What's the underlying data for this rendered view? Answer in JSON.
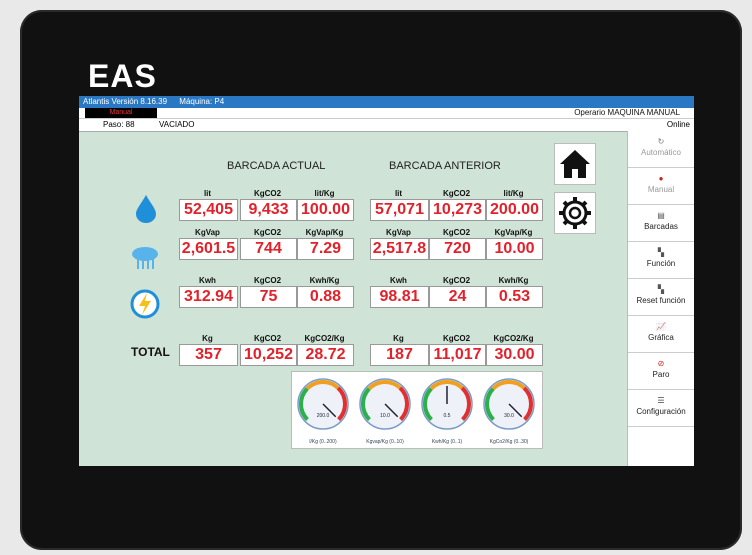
{
  "brand": "EAS",
  "header": {
    "version": "Atlantis Versión 8.16.39",
    "machine": "Máquina: P4",
    "mode_tag": "Manual",
    "operator": "Operario  MAQUINA MANUAL",
    "step": "Paso: 88",
    "step_name": "VACIADO",
    "connection": "Online"
  },
  "sections": {
    "actual": "BARCADA ACTUAL",
    "anterior": "BARCADA ANTERIOR",
    "total_label": "TOTAL"
  },
  "rows": [
    {
      "icon": "water-drop-icon",
      "headers": [
        "lit",
        "KgCO2",
        "lit/Kg"
      ],
      "actual": [
        "52,405",
        "9,433",
        "100.00"
      ],
      "anterior": [
        "57,071",
        "10,273",
        "200.00"
      ]
    },
    {
      "icon": "steam-icon",
      "headers": [
        "KgVap",
        "KgCO2",
        "KgVap/Kg"
      ],
      "actual": [
        "2,601.5",
        "744",
        "7.29"
      ],
      "anterior": [
        "2,517.8",
        "720",
        "10.00"
      ]
    },
    {
      "icon": "electricity-icon",
      "headers": [
        "Kwh",
        "KgCO2",
        "Kwh/Kg"
      ],
      "actual": [
        "312.94",
        "75",
        "0.88"
      ],
      "anterior": [
        "98.81",
        "24",
        "0.53"
      ]
    },
    {
      "icon": "total",
      "headers": [
        "Kg",
        "KgCO2",
        "KgCO2/Kg"
      ],
      "actual": [
        "357",
        "10,252",
        "28.72"
      ],
      "anterior": [
        "187",
        "11,017",
        "30.00"
      ]
    }
  ],
  "gauges": [
    {
      "value": "200.0",
      "label": "l/Kg (0..200)",
      "level": 1.0
    },
    {
      "value": "10.0",
      "label": "Kgvap/Kg (0..10)",
      "level": 1.0
    },
    {
      "value": "0.5",
      "label": "Kwh/Kg (0..1)",
      "level": 0.5
    },
    {
      "value": "30.0",
      "label": "KgCo2/Kg (0..30)",
      "level": 1.0
    }
  ],
  "sidebar": [
    {
      "label": "Automático",
      "icon": "refresh-icon",
      "enabled": false
    },
    {
      "label": "Manual",
      "icon": "hand-icon",
      "enabled": false
    },
    {
      "label": "Barcadas",
      "icon": "document-icon",
      "enabled": true
    },
    {
      "label": "Función",
      "icon": "function-icon",
      "enabled": true
    },
    {
      "label": "Reset función",
      "icon": "reset-icon",
      "enabled": true
    },
    {
      "label": "Gráfica",
      "icon": "chart-icon",
      "enabled": true
    },
    {
      "label": "Paro",
      "icon": "stop-icon",
      "enabled": true
    },
    {
      "label": "Configuración",
      "icon": "settings-icon",
      "enabled": true
    }
  ],
  "colors": {
    "screen_bg": "#cfe3d6",
    "value_text": "#e2222b",
    "title_bar": "#2a78c4"
  }
}
